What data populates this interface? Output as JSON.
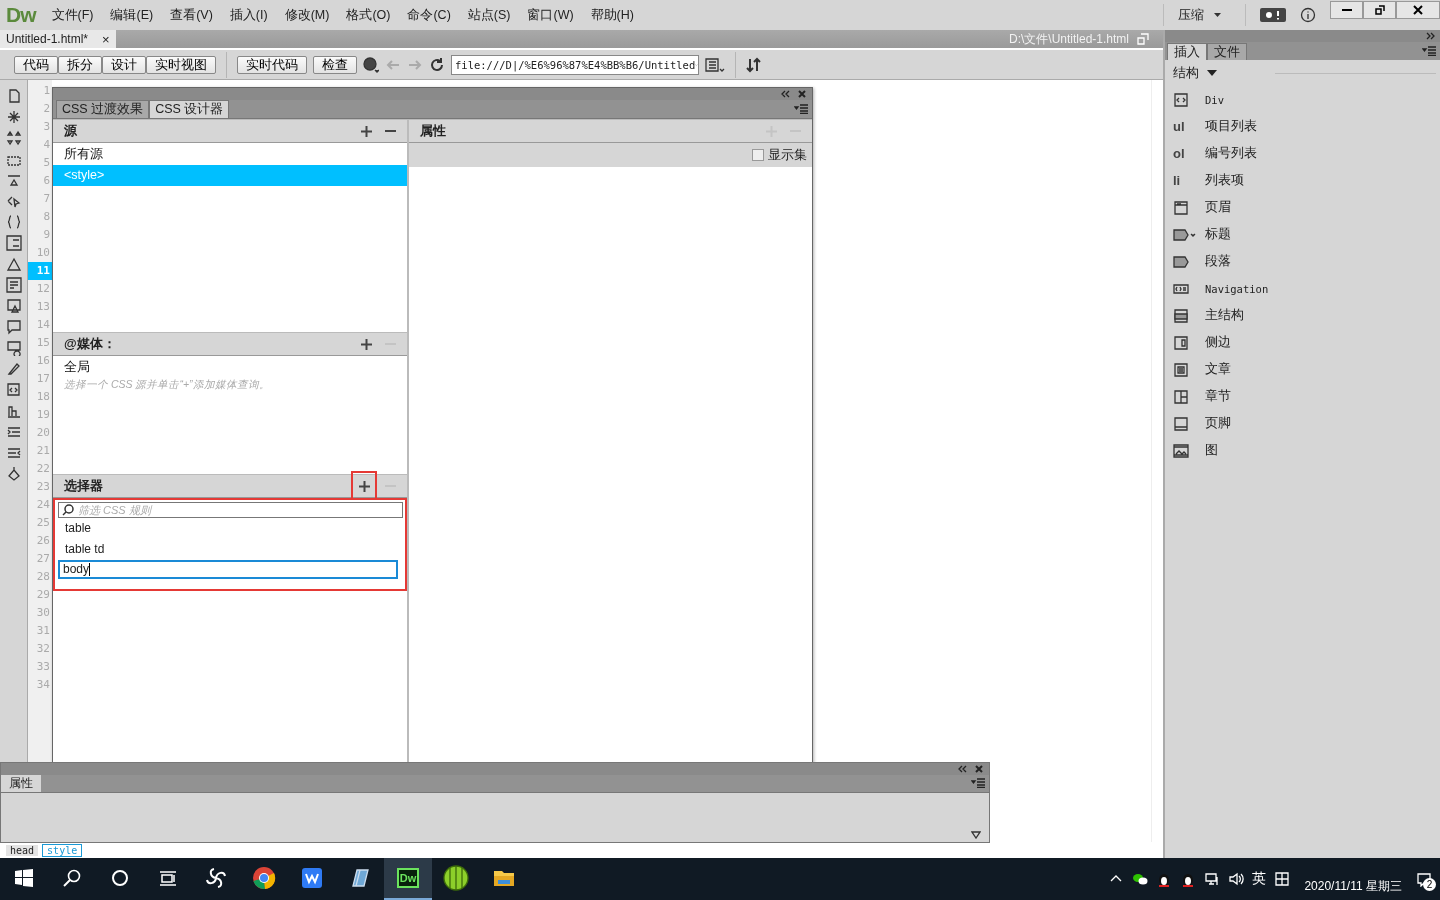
{
  "app": {
    "logo": "Dw"
  },
  "menu": [
    "文件(F)",
    "编辑(E)",
    "查看(V)",
    "插入(I)",
    "修改(M)",
    "格式(O)",
    "命令(C)",
    "站点(S)",
    "窗口(W)",
    "帮助(H)"
  ],
  "workspace": {
    "label": "压缩"
  },
  "document_tab": {
    "title": "Untitled-1.html*",
    "close": "×"
  },
  "file_path": "D:\\文件\\Untitled-1.html",
  "toolbar": {
    "view_buttons": [
      "代码",
      "拆分",
      "设计",
      "实时视图"
    ],
    "buttons": [
      "实时代码",
      "检查"
    ],
    "address": "file:///D|/%E6%96%87%E4%BB%B6/Untitled"
  },
  "editor": {
    "line_numbers": [
      {
        "n": "1",
        "current": false
      },
      {
        "n": "2",
        "current": false
      },
      {
        "n": "3",
        "current": false
      },
      {
        "n": "4",
        "current": false
      },
      {
        "n": "5",
        "current": false
      },
      {
        "n": "6",
        "current": false
      },
      {
        "n": "7",
        "current": false
      },
      {
        "n": "8",
        "current": false
      },
      {
        "n": "9",
        "current": false
      },
      {
        "n": "10",
        "current": false
      },
      {
        "n": "11",
        "current": true
      },
      {
        "n": "12",
        "current": false
      },
      {
        "n": "13",
        "current": false
      },
      {
        "n": "14",
        "current": false
      },
      {
        "n": "15",
        "current": false
      },
      {
        "n": "16",
        "current": false
      },
      {
        "n": "17",
        "current": false
      },
      {
        "n": "18",
        "current": false
      },
      {
        "n": "19",
        "current": false
      },
      {
        "n": "20",
        "current": false
      },
      {
        "n": "21",
        "current": false
      },
      {
        "n": "22",
        "current": false
      },
      {
        "n": "23",
        "current": false
      },
      {
        "n": "24",
        "current": false
      },
      {
        "n": "25",
        "current": false
      },
      {
        "n": "26",
        "current": false
      },
      {
        "n": "27",
        "current": false
      },
      {
        "n": "28",
        "current": false
      },
      {
        "n": "29",
        "current": false
      },
      {
        "n": "30",
        "current": false
      },
      {
        "n": "31",
        "current": false
      },
      {
        "n": "32",
        "current": false
      },
      {
        "n": "33",
        "current": false
      },
      {
        "n": "34",
        "current": false
      }
    ]
  },
  "css_designer": {
    "tabs": [
      {
        "label": "CSS 过渡效果",
        "selected": false
      },
      {
        "label": "CSS 设计器",
        "selected": true
      }
    ],
    "sources": {
      "title": "源",
      "add_disabled": false,
      "remove_disabled": false,
      "items": [
        {
          "label": "所有源",
          "selected": false
        },
        {
          "label": "<style>",
          "selected": true
        }
      ]
    },
    "media": {
      "title": "@媒体：",
      "add_disabled": false,
      "remove_disabled": true,
      "items": [
        "全局"
      ],
      "hint": "选择一个 CSS 源并单击“+”添加媒体查询。"
    },
    "selectors": {
      "title": "选择器",
      "add_disabled": false,
      "remove_disabled": true,
      "highlighted": true,
      "filter_placeholder": "筛选 CSS 规则",
      "items": [
        "table",
        "table td"
      ],
      "editing": "body"
    },
    "properties": {
      "title": "属性",
      "add_disabled": true,
      "remove_disabled": true,
      "show_set": {
        "label": "显示集",
        "checked": false
      }
    }
  },
  "properties_panel": {
    "tab": "属性"
  },
  "tag_selector": [
    {
      "label": "head",
      "selected": false
    },
    {
      "label": "style",
      "selected": true
    }
  ],
  "insert_panel": {
    "tabs": [
      {
        "label": "插入",
        "selected": true
      },
      {
        "label": "文件",
        "selected": false
      }
    ],
    "category": "结构",
    "items": [
      {
        "label": "Div",
        "mono": true
      },
      {
        "tag": "ul",
        "label": "项目列表"
      },
      {
        "tag": "ol",
        "label": "编号列表"
      },
      {
        "tag": "li",
        "label": "列表项"
      },
      {
        "label": "页眉"
      },
      {
        "label": "标题"
      },
      {
        "label": "段落"
      },
      {
        "label": "Navigation",
        "mono": true
      },
      {
        "label": "主结构"
      },
      {
        "label": "侧边"
      },
      {
        "label": "文章"
      },
      {
        "label": "章节"
      },
      {
        "label": "页脚"
      },
      {
        "label": "图"
      }
    ]
  },
  "taskbar": {
    "apps": [
      {
        "kind": "pinwheel",
        "selected": false
      },
      {
        "kind": "chrome",
        "selected": false
      },
      {
        "kind": "wps",
        "selected": false
      },
      {
        "kind": "notebook",
        "selected": false
      },
      {
        "kind": "dw",
        "label": "Dw",
        "selected": true
      },
      {
        "kind": "ball",
        "selected": false
      },
      {
        "kind": "folder",
        "selected": false
      }
    ],
    "language": "英",
    "date": "2020/11/11 星期三",
    "notifications": "2"
  }
}
